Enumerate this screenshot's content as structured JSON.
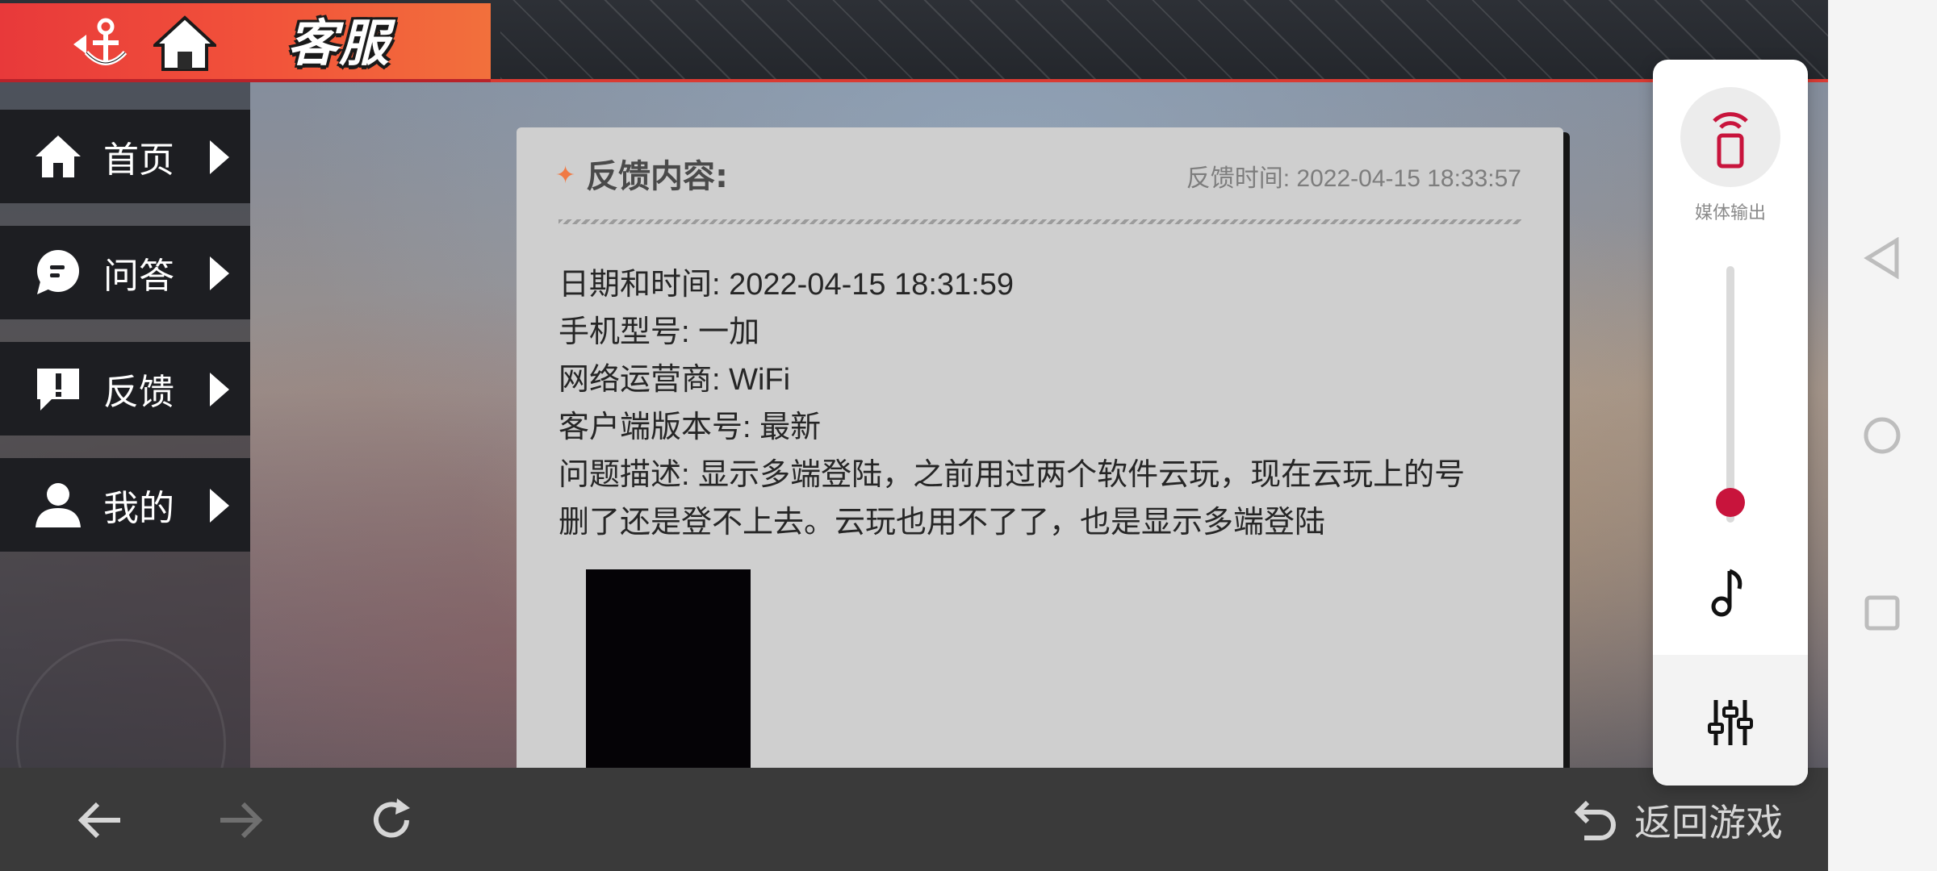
{
  "header": {
    "title": "客服",
    "icons": [
      "anchor-back-icon",
      "home-icon"
    ]
  },
  "sidebar": {
    "items": [
      {
        "label": "首页",
        "icon": "home-icon"
      },
      {
        "label": "问答",
        "icon": "chat-bubble-icon"
      },
      {
        "label": "反馈",
        "icon": "exclamation-bubble-icon"
      },
      {
        "label": "我的",
        "icon": "person-icon"
      }
    ]
  },
  "feedback": {
    "title": "反馈内容:",
    "time": "反馈时间: 2022-04-15 18:33:57",
    "lines": [
      "日期和时间: 2022-04-15 18:31:59",
      "手机型号: 一加",
      "网络运营商: WiFi",
      "客户端版本号: 最新",
      "问题描述: 显示多端登陆，之前用过两个软件云玩，现在云玩上的号",
      "删了还是登不上去。云玩也用不了了，也是显示多端登陆"
    ]
  },
  "bottombar": {
    "return_label": "返回游戏"
  },
  "volume_panel": {
    "cast_label": "媒体输出",
    "accent_color": "#c8143c",
    "volume_level": 0.08
  },
  "colors": {
    "header_tab": "#e8393a",
    "header_border": "#d93b33",
    "sidebar_bg": "#1d1e22",
    "card_bg": "#cfcfcf",
    "bottombar_bg": "#3a3a3a"
  }
}
